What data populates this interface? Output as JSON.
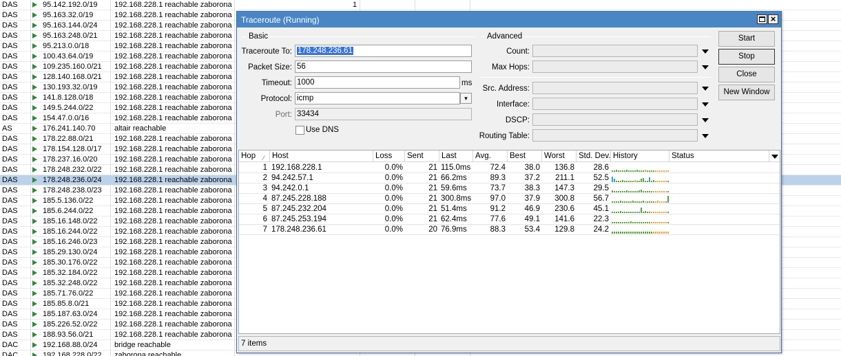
{
  "route_list": {
    "top_row": {
      "flag": "DAS",
      "dst": "95.142.192.0/19",
      "gateway": "192.168.228.1 reachable zaborona",
      "count": "1"
    },
    "rows": [
      {
        "flag": "DAS",
        "dst": "95.163.32.0/19",
        "gateway": "192.168.228.1 reachable zaborona"
      },
      {
        "flag": "DAS",
        "dst": "95.163.144.0/24",
        "gateway": "192.168.228.1 reachable zaborona"
      },
      {
        "flag": "DAS",
        "dst": "95.163.248.0/21",
        "gateway": "192.168.228.1 reachable zaborona"
      },
      {
        "flag": "DAS",
        "dst": "95.213.0.0/18",
        "gateway": "192.168.228.1 reachable zaborona"
      },
      {
        "flag": "DAS",
        "dst": "100.43.64.0/19",
        "gateway": "192.168.228.1 reachable zaborona"
      },
      {
        "flag": "DAS",
        "dst": "109.235.160.0/21",
        "gateway": "192.168.228.1 reachable zaborona"
      },
      {
        "flag": "DAS",
        "dst": "128.140.168.0/21",
        "gateway": "192.168.228.1 reachable zaborona"
      },
      {
        "flag": "DAS",
        "dst": "130.193.32.0/19",
        "gateway": "192.168.228.1 reachable zaborona"
      },
      {
        "flag": "DAS",
        "dst": "141.8.128.0/18",
        "gateway": "192.168.228.1 reachable zaborona"
      },
      {
        "flag": "DAS",
        "dst": "149.5.244.0/22",
        "gateway": "192.168.228.1 reachable zaborona"
      },
      {
        "flag": "DAS",
        "dst": "154.47.0.0/16",
        "gateway": "192.168.228.1 reachable zaborona"
      },
      {
        "flag": "AS",
        "dst": "176.241.140.70",
        "gateway": "altair reachable"
      },
      {
        "flag": "DAS",
        "dst": "178.22.88.0/21",
        "gateway": "192.168.228.1 reachable zaborona"
      },
      {
        "flag": "DAS",
        "dst": "178.154.128.0/17",
        "gateway": "192.168.228.1 reachable zaborona"
      },
      {
        "flag": "DAS",
        "dst": "178.237.16.0/20",
        "gateway": "192.168.228.1 reachable zaborona"
      },
      {
        "flag": "DAS",
        "dst": "178.248.232.0/22",
        "gateway": "192.168.228.1 reachable zaborona"
      },
      {
        "flag": "DAS",
        "dst": "178.248.236.0/24",
        "gateway": "192.168.228.1 reachable zaborona",
        "selected": true
      },
      {
        "flag": "DAS",
        "dst": "178.248.238.0/23",
        "gateway": "192.168.228.1 reachable zaborona"
      },
      {
        "flag": "DAS",
        "dst": "185.5.136.0/22",
        "gateway": "192.168.228.1 reachable zaborona"
      },
      {
        "flag": "DAS",
        "dst": "185.6.244.0/22",
        "gateway": "192.168.228.1 reachable zaborona"
      },
      {
        "flag": "DAS",
        "dst": "185.16.148.0/22",
        "gateway": "192.168.228.1 reachable zaborona"
      },
      {
        "flag": "DAS",
        "dst": "185.16.244.0/22",
        "gateway": "192.168.228.1 reachable zaborona"
      },
      {
        "flag": "DAS",
        "dst": "185.16.246.0/23",
        "gateway": "192.168.228.1 reachable zaborona"
      },
      {
        "flag": "DAS",
        "dst": "185.29.130.0/24",
        "gateway": "192.168.228.1 reachable zaborona"
      },
      {
        "flag": "DAS",
        "dst": "185.30.176.0/22",
        "gateway": "192.168.228.1 reachable zaborona"
      },
      {
        "flag": "DAS",
        "dst": "185.32.184.0/22",
        "gateway": "192.168.228.1 reachable zaborona"
      },
      {
        "flag": "DAS",
        "dst": "185.32.248.0/22",
        "gateway": "192.168.228.1 reachable zaborona"
      },
      {
        "flag": "DAS",
        "dst": "185.71.76.0/22",
        "gateway": "192.168.228.1 reachable zaborona"
      },
      {
        "flag": "DAS",
        "dst": "185.85.8.0/21",
        "gateway": "192.168.228.1 reachable zaborona"
      },
      {
        "flag": "DAS",
        "dst": "185.187.63.0/24",
        "gateway": "192.168.228.1 reachable zaborona"
      },
      {
        "flag": "DAS",
        "dst": "185.226.52.0/22",
        "gateway": "192.168.228.1 reachable zaborona"
      },
      {
        "flag": "DAS",
        "dst": "188.93.56.0/21",
        "gateway": "192.168.228.1 reachable zaborona"
      },
      {
        "flag": "DAC",
        "dst": "192.168.88.0/24",
        "gateway": "bridge reachable"
      },
      {
        "flag": "DAC",
        "dst": "192.168.228.0/22",
        "gateway": "zaborona reachable"
      }
    ]
  },
  "window": {
    "title": "Traceroute (Running)",
    "basic_label": "Basic",
    "advanced_label": "Advanced",
    "traceroute_to_label": "Traceroute To:",
    "traceroute_to_value": "178.248.236.61",
    "packet_size_label": "Packet Size:",
    "packet_size_value": "56",
    "timeout_label": "Timeout:",
    "timeout_value": "1000",
    "timeout_unit": "ms",
    "protocol_label": "Protocol:",
    "protocol_value": "icmp",
    "port_label": "Port:",
    "port_value": "33434",
    "use_dns_label": "Use DNS",
    "count_label": "Count:",
    "max_hops_label": "Max Hops:",
    "src_address_label": "Src. Address:",
    "interface_label": "Interface:",
    "dscp_label": "DSCP:",
    "routing_table_label": "Routing Table:",
    "buttons": {
      "start": "Start",
      "stop": "Stop",
      "close": "Close",
      "new_window": "New Window"
    },
    "table_headers": {
      "hop": "Hop",
      "host": "Host",
      "loss": "Loss",
      "sent": "Sent",
      "last": "Last",
      "avg": "Avg.",
      "best": "Best",
      "worst": "Worst",
      "std_dev": "Std. Dev.",
      "history": "History",
      "status": "Status"
    },
    "hops": [
      {
        "hop": "1",
        "host": "192.168.228.1",
        "loss": "0.0%",
        "sent": "21",
        "last": "115.0ms",
        "avg": "72.4",
        "best": "38.0",
        "worst": "136.8",
        "std_dev": "28.6",
        "history": [
          2,
          2,
          3,
          2,
          2,
          2,
          2,
          3,
          2,
          2,
          2,
          2,
          3,
          2,
          2,
          2,
          3,
          2,
          2,
          2,
          2,
          2,
          2,
          2,
          2,
          2,
          2,
          2
        ],
        "history_colors": "ggggggggggggggggoggggooooooo"
      },
      {
        "hop": "2",
        "host": "94.242.57.1",
        "loss": "0.0%",
        "sent": "21",
        "last": "66.2ms",
        "avg": "89.3",
        "best": "37.2",
        "worst": "211.1",
        "std_dev": "52.5",
        "history": [
          8,
          5,
          2,
          2,
          2,
          3,
          2,
          2,
          2,
          2,
          2,
          3,
          2,
          2,
          5,
          6,
          2,
          2,
          7,
          2,
          3,
          2,
          2,
          2,
          2,
          2,
          2,
          2
        ],
        "history_colors": "bbgggggggggoggggggbggoooooo"
      },
      {
        "hop": "3",
        "host": "94.242.0.1",
        "loss": "0.0%",
        "sent": "21",
        "last": "59.6ms",
        "avg": "73.7",
        "best": "38.3",
        "worst": "147.3",
        "std_dev": "29.5",
        "history": [
          3,
          2,
          2,
          2,
          2,
          2,
          2,
          3,
          2,
          2,
          2,
          2,
          2,
          3,
          4,
          2,
          2,
          2,
          2,
          2,
          2,
          2,
          2,
          2,
          2,
          2,
          2,
          2
        ],
        "history_colors": "ggggggggggggggggggggooooooo"
      },
      {
        "hop": "4",
        "host": "87.245.228.188",
        "loss": "0.0%",
        "sent": "21",
        "last": "300.8ms",
        "avg": "97.0",
        "best": "37.9",
        "worst": "300.8",
        "std_dev": "56.7",
        "history": [
          2,
          2,
          2,
          2,
          3,
          2,
          2,
          2,
          2,
          2,
          3,
          2,
          2,
          2,
          2,
          3,
          2,
          2,
          2,
          2,
          2,
          2,
          3,
          2,
          2,
          2,
          2,
          10
        ],
        "history_colors": "ggggggggggggggggoggggooooob"
      },
      {
        "hop": "5",
        "host": "87.245.232.204",
        "loss": "0.0%",
        "sent": "21",
        "last": "51.4ms",
        "avg": "91.2",
        "best": "46.9",
        "worst": "230.6",
        "std_dev": "45.1",
        "history": [
          2,
          2,
          2,
          2,
          3,
          2,
          2,
          2,
          2,
          2,
          2,
          2,
          2,
          2,
          8,
          2,
          3,
          2,
          2,
          2,
          2,
          2,
          2,
          2,
          2,
          2,
          2,
          2
        ],
        "history_colors": "gggggggggggggbgggggoooooooo"
      },
      {
        "hop": "6",
        "host": "87.245.253.194",
        "loss": "0.0%",
        "sent": "21",
        "last": "62.4ms",
        "avg": "77.6",
        "best": "49.1",
        "worst": "141.6",
        "std_dev": "22.3",
        "history": [
          2,
          2,
          2,
          2,
          2,
          2,
          2,
          2,
          2,
          3,
          2,
          2,
          2,
          2,
          2,
          2,
          2,
          2,
          2,
          2,
          2,
          2,
          2,
          2,
          2,
          2,
          2,
          2
        ],
        "history_colors": "gggggggggggggggggggoooooooo"
      },
      {
        "hop": "7",
        "host": "178.248.236.61",
        "loss": "0.0%",
        "sent": "20",
        "last": "76.9ms",
        "avg": "88.3",
        "best": "53.4",
        "worst": "129.8",
        "std_dev": "24.2",
        "history": [
          3,
          3,
          3,
          3,
          3,
          3,
          3,
          3,
          3,
          3,
          3,
          3,
          3,
          3,
          3,
          3,
          3,
          3,
          3,
          3,
          3,
          3,
          3,
          3,
          3,
          3,
          3,
          3
        ],
        "history_colors": "ggggggggggggggggggggoooooooo"
      }
    ],
    "status_items": "7 items",
    "colors": {
      "titlebar": "#4a86c5",
      "selection": "#3874d8",
      "history_green": "#5aa03c",
      "history_blue": "#2e9fd0",
      "history_orange": "#e8a33a"
    }
  }
}
